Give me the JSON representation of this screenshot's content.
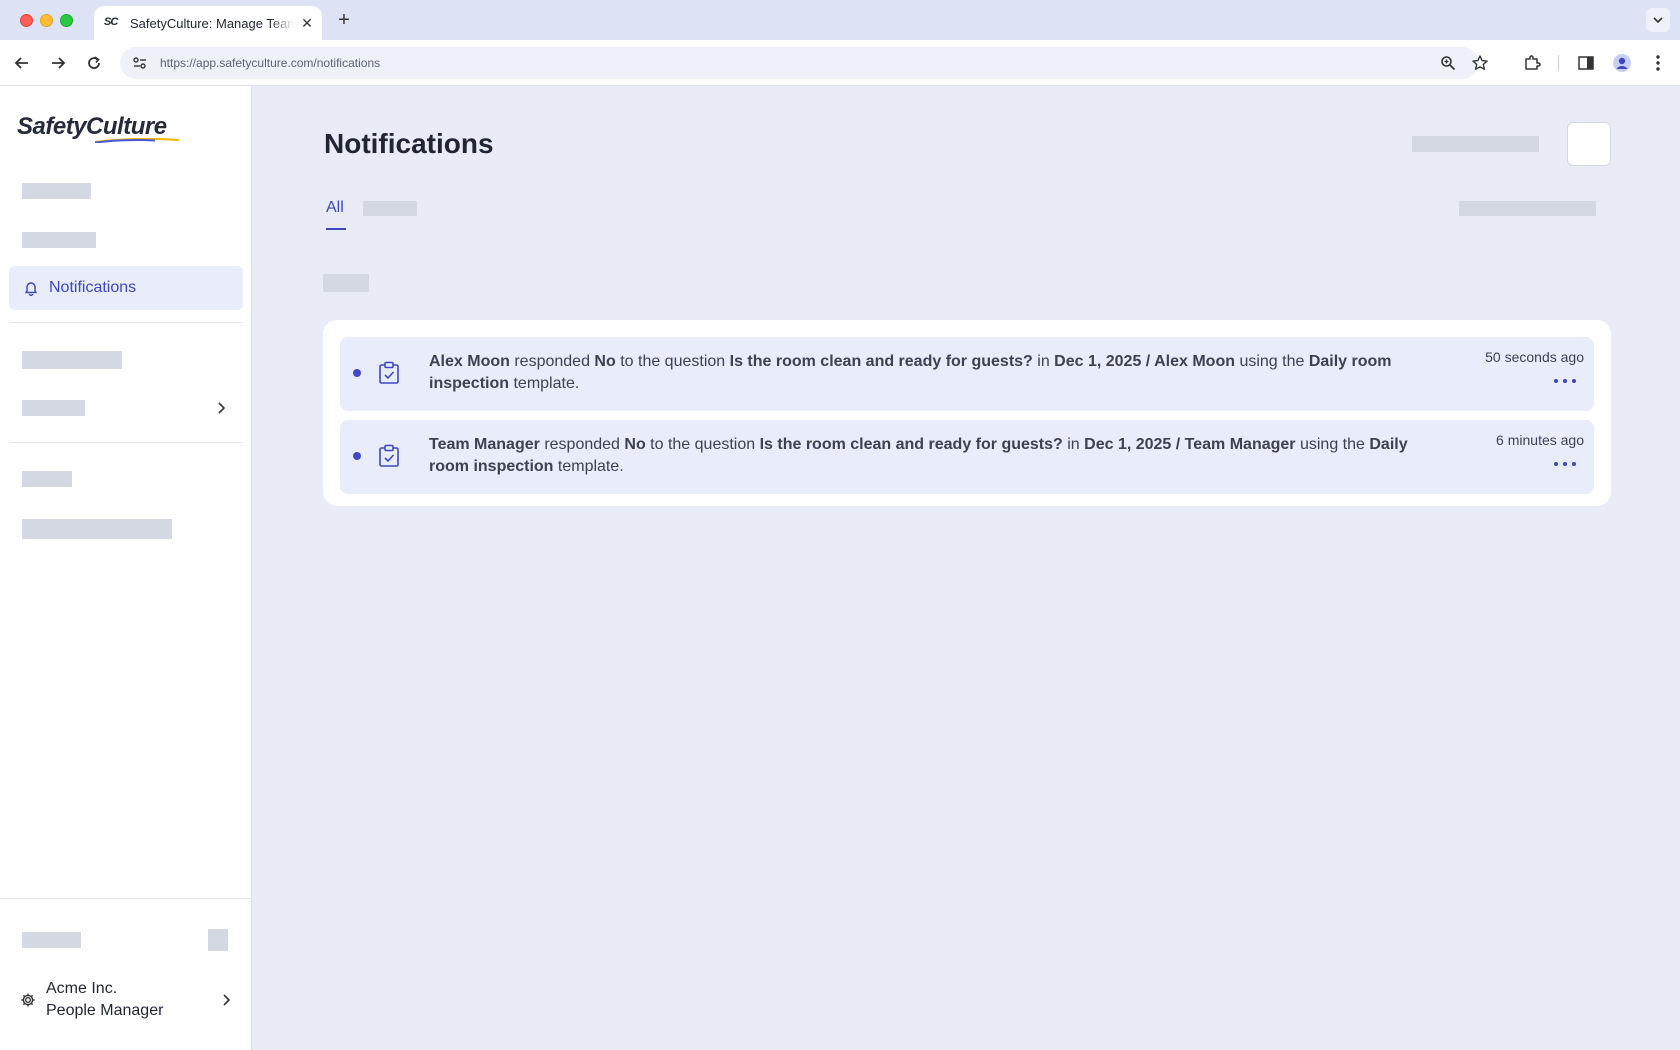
{
  "browser": {
    "tab_title": "SafetyCulture: Manage Teams",
    "tab_favicon": "SC",
    "url": "https://app.safetyculture.com/notifications"
  },
  "sidebar": {
    "logo_text": "SafetyCulture",
    "active_item": {
      "label": "Notifications",
      "icon": "bell-icon"
    },
    "org": {
      "name": "Acme Inc.",
      "role": "People Manager"
    }
  },
  "main": {
    "title": "Notifications",
    "tabs": [
      {
        "label": "All",
        "active": true
      }
    ],
    "notifications": [
      {
        "actor": "Alex Moon",
        "verb": "responded",
        "response": "No",
        "q_prefix": "to the question",
        "question": "Is the room clean and ready for guests?",
        "in": "in",
        "inspection": "Dec 1, 2025 / Alex Moon",
        "using": "using the",
        "template": "Daily room inspection",
        "suffix": "template.",
        "time": "50 seconds ago",
        "unread": true
      },
      {
        "actor": "Team Manager",
        "verb": "responded",
        "response": "No",
        "q_prefix": "to the question",
        "question": "Is the room clean and ready for guests?",
        "in": "in",
        "inspection": "Dec 1, 2025 / Team Manager",
        "using": "using the",
        "template": "Daily room inspection",
        "suffix": "template.",
        "time": "6 minutes ago",
        "unread": true
      }
    ]
  },
  "colors": {
    "accent": "#3d47c0",
    "unread_dot": "#4149c8",
    "background": "#e9ecf7"
  }
}
